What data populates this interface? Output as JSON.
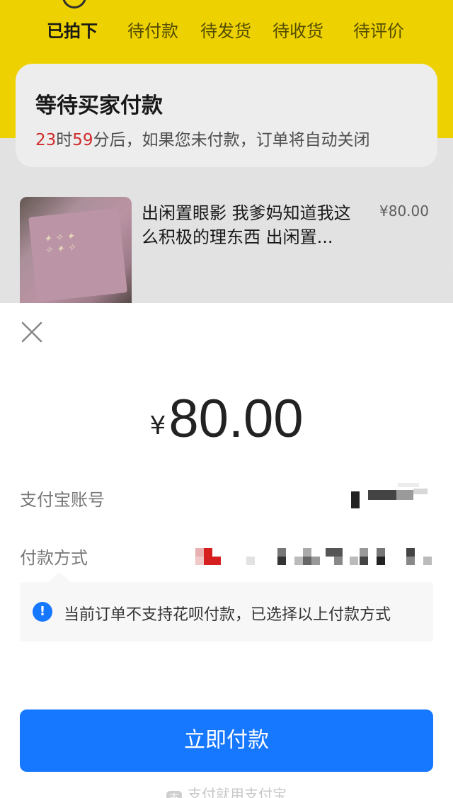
{
  "background": {
    "tabs": [
      {
        "label": "已拍下",
        "active": true
      },
      {
        "label": "待付款",
        "active": false
      },
      {
        "label": "待发货",
        "active": false
      },
      {
        "label": "待收货",
        "active": false
      },
      {
        "label": "待评价",
        "active": false
      }
    ],
    "status": {
      "title": "等待买家付款",
      "hours": "23",
      "hours_unit": "时",
      "minutes": "59",
      "rest": "分后，如果您未付款，订单将自动关闭"
    },
    "product": {
      "title": "出闲置眼影 我爹妈知道我这么积极的理东西 出闲置...",
      "price": "¥80.00"
    }
  },
  "payment": {
    "currency_symbol": "¥",
    "amount": "80.00",
    "account_label": "支付宝账号",
    "method_label": "付款方式",
    "notice": "当前订单不支持花呗付款，已选择以上付款方式",
    "pay_button": "立即付款",
    "footer": "支付就用支付宝",
    "footer_logo": "支"
  },
  "colors": {
    "brand_yellow": "#ffe100",
    "pay_blue": "#1677ff",
    "countdown_red": "#e03030"
  },
  "icons": {
    "close": "close-icon",
    "info": "info-icon"
  }
}
